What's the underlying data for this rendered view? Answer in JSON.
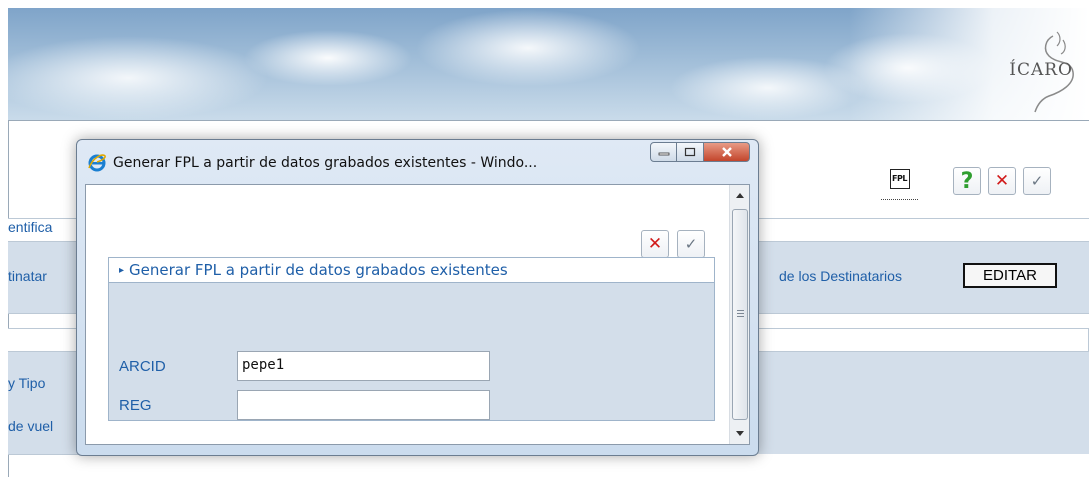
{
  "banner": {
    "logo_text": "ÍCARO"
  },
  "toolbar": {
    "fpl_label": "FPL",
    "help_glyph": "?",
    "cancel_glyph": "✕",
    "accept_glyph": "✓"
  },
  "background": {
    "row1_text": "entifica",
    "row2_left_text": "tinatar",
    "row2_right_text": "de los Destinatarios",
    "editar_label": "EDITAR",
    "row3_text": "y Tipo",
    "row4_text": "de vuel"
  },
  "popup": {
    "title": "Generar FPL a partir de datos grabados existentes - Windo...",
    "controls": {
      "minimize": "—",
      "maximize": "▢",
      "close": "X"
    },
    "cancel_glyph": "✕",
    "accept_glyph": "✓",
    "form": {
      "header": "Generar FPL a partir de datos grabados existentes",
      "fields": [
        {
          "label": "ARCID",
          "value": "pepe1"
        },
        {
          "label": "REG",
          "value": ""
        }
      ]
    }
  },
  "colors": {
    "accent": "#1f5fa8",
    "panel": "#d3deea",
    "danger": "#d11a1a",
    "help": "#2f9e2f"
  },
  "icons": [
    "ie-icon",
    "fpl-icon",
    "help-icon",
    "cancel-icon",
    "accept-icon",
    "logo-bird-icon"
  ]
}
